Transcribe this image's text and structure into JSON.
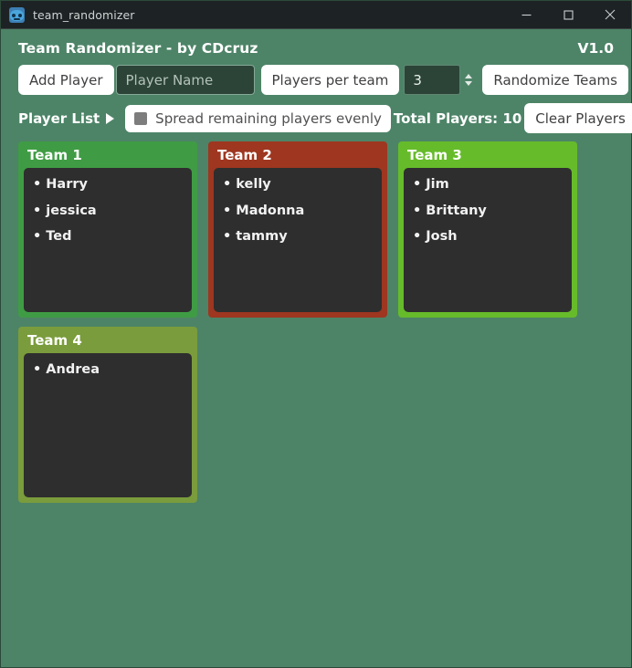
{
  "titlebar": {
    "title": "team_randomizer",
    "icon": "godot-robot-icon",
    "minimize_label": "—",
    "maximize_label": "□",
    "close_label": "✕"
  },
  "header": {
    "app_title": "Team Randomizer - by CDcruz",
    "version": "V1.0"
  },
  "toolbar": {
    "add_player_label": "Add Player",
    "player_name_value": "",
    "player_name_placeholder": "Player Name",
    "players_per_team_label": "Players per team",
    "players_per_team_value": "3",
    "randomize_teams_label": "Randomize Teams",
    "player_list_label": "Player List",
    "player_list_caret": "▶",
    "spread_checkbox_label": "Spread remaining players evenly",
    "spread_checkbox_checked": false,
    "total_players_label": "Total Players: 10",
    "clear_players_label": "Clear Players"
  },
  "colors": {
    "window_background": "#4d8467",
    "titlebar_background": "#1d2324",
    "team1": "#3f9c44",
    "team2": "#9e3620",
    "team3": "#66bb2a",
    "team4": "#7a9c3c",
    "list_background": "#2e2e2e",
    "pill_background": "#ffffff"
  },
  "teams": [
    {
      "name": "Team 1",
      "color": "#3f9c44",
      "players": [
        "Harry",
        "jessica",
        "Ted"
      ]
    },
    {
      "name": "Team 2",
      "color": "#9e3620",
      "players": [
        "kelly",
        "Madonna",
        "tammy"
      ]
    },
    {
      "name": "Team 3",
      "color": "#66bb2a",
      "players": [
        "Jim",
        "Brittany",
        "Josh"
      ]
    },
    {
      "name": "Team 4",
      "color": "#7a9c3c",
      "players": [
        "Andrea"
      ]
    }
  ],
  "bullet": "•"
}
